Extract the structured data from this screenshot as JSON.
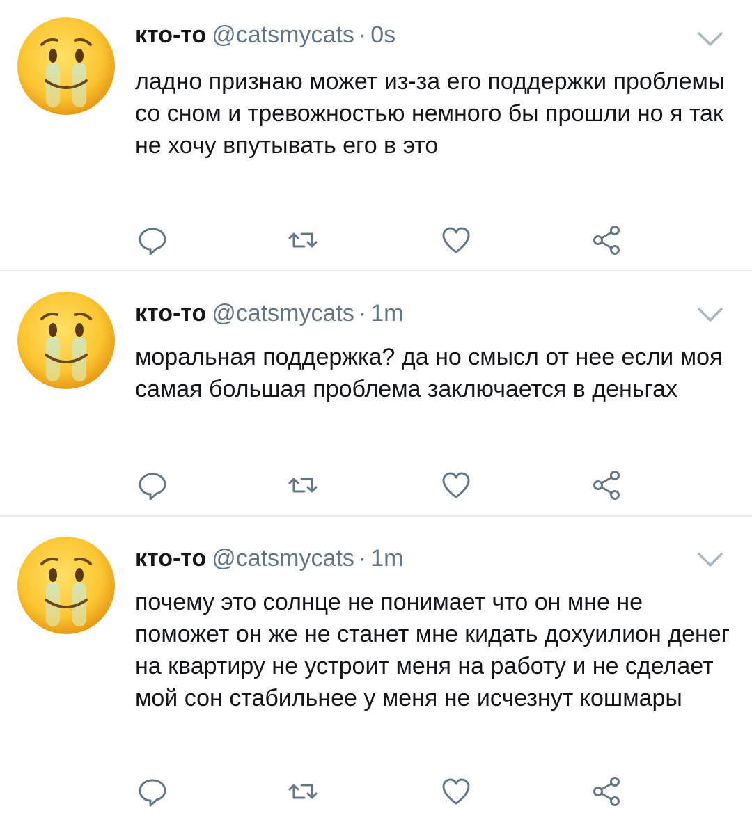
{
  "colors": {
    "text": "#14171a",
    "secondary": "#657786",
    "divider": "#e6ecf0"
  },
  "icons": {
    "avatar": "crying-face-emoji-icon",
    "menu": "chevron-down-icon",
    "reply": "reply-icon",
    "retweet": "retweet-icon",
    "like": "heart-icon",
    "share": "share-icon"
  },
  "tweets": [
    {
      "name": "кто-то",
      "handle": "@catsmycats",
      "dot": "·",
      "time": "0s",
      "text": "ладно признаю может из-за его поддержки проблемы со сном и тревожностью немного бы прошли но я так не хочу впутывать его в это"
    },
    {
      "name": "кто-то",
      "handle": "@catsmycats",
      "dot": "·",
      "time": "1m",
      "text": "моральная поддержка? да но смысл от нее если моя самая большая проблема заключается в деньгах"
    },
    {
      "name": "кто-то",
      "handle": "@catsmycats",
      "dot": "·",
      "time": "1m",
      "text": "почему это солнце не понимает что  он мне не поможет он же не станет мне кидать дохуилион денег на квартиру не устроит меня на работу и не сделает мой сон стабильнее у меня не исчезнут кошмары"
    }
  ]
}
